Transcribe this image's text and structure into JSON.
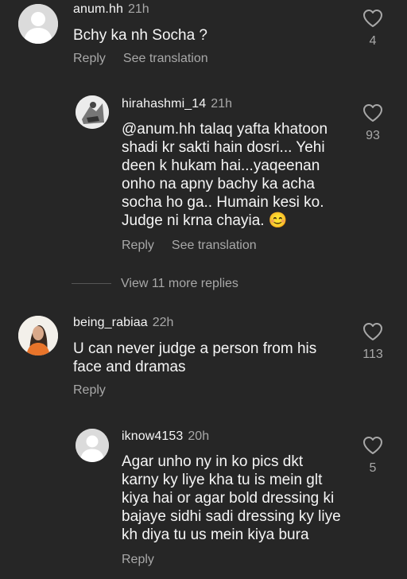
{
  "comments": [
    {
      "username": "anum.hh",
      "time": "21h",
      "text": "Bchy ka nh Socha ?",
      "likes": "4",
      "reply": "Reply",
      "translate": "See translation"
    },
    {
      "username": "hirahashmi_14",
      "time": "21h",
      "text": "@anum.hh talaq yafta khatoon\nshadi kr sakti hain dosri... Yehi\ndeen k hukam hai...yaqeenan\nonho na apny bachy ka acha\nsocha ho ga.. Humain kesi ko.\nJudge ni krna chayia. 😊",
      "likes": "93",
      "reply": "Reply",
      "translate": "See translation"
    },
    {
      "username": "being_rabiaa",
      "time": "22h",
      "text": "U can never judge a person from his\nface and dramas",
      "likes": "113",
      "reply": "Reply"
    },
    {
      "username": "iknow4153",
      "time": "20h",
      "text": "Agar unho ny in ko pics dkt\nkarny ky liye kha tu is mein glt\nkiya hai or agar bold dressing ki\nbajaye sidhi sadi dressing ky liye\nkh diya tu us mein kiya bura",
      "likes": "5",
      "reply": "Reply"
    }
  ],
  "view_more": "View 11 more replies",
  "icons": {
    "heart": "heart-icon",
    "default_avatar": "default-avatar-icon"
  },
  "colors": {
    "background": "#262626",
    "primary_text": "#f5f5f5",
    "secondary_text": "#a8a8a8"
  }
}
